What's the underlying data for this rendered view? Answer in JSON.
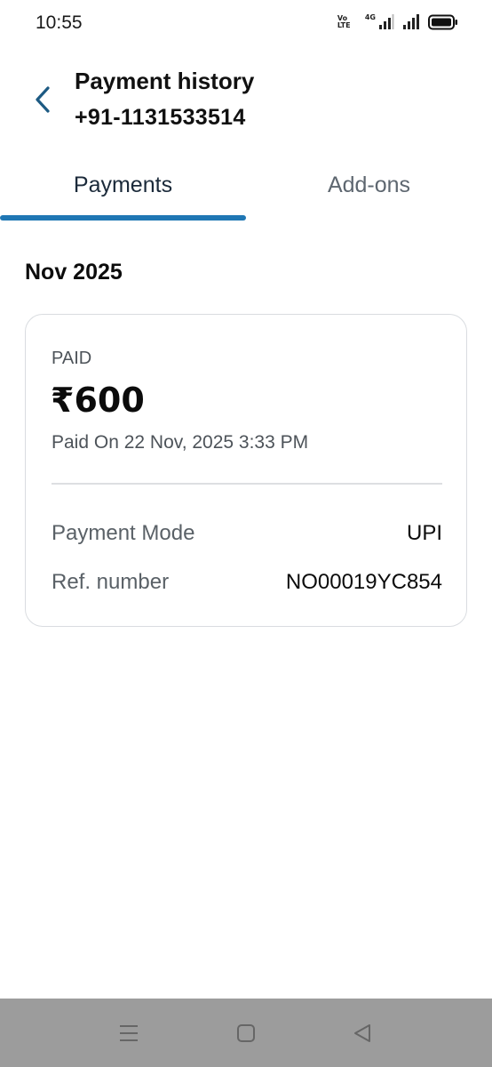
{
  "status_bar": {
    "time": "10:55",
    "volte_label": "Vo LTE",
    "network_label": "4G",
    "icons": [
      "volte-icon",
      "signal-icon",
      "signal-icon",
      "battery-icon"
    ]
  },
  "header": {
    "title": "Payment history",
    "subtitle": "+91-1131533514",
    "back_icon": "chevron-left-icon"
  },
  "tabs": [
    {
      "label": "Payments",
      "active": true
    },
    {
      "label": "Add-ons",
      "active": false
    }
  ],
  "month_heading": "Nov 2025",
  "payment_card": {
    "status": "PAID",
    "amount": "₹600",
    "paid_on": "Paid On 22 Nov, 2025 3:33 PM",
    "details": [
      {
        "label": "Payment Mode",
        "value": "UPI"
      },
      {
        "label": "Ref. number",
        "value": "NO00019YC854"
      }
    ]
  },
  "nav_bar": {
    "buttons": [
      "menu-icon",
      "home-icon",
      "back-icon"
    ]
  },
  "colors": {
    "accent": "#1f77b4",
    "back_arrow": "#1d5a83",
    "nav_bar_bg": "#9c9c9c",
    "card_border": "#d9dce0"
  }
}
